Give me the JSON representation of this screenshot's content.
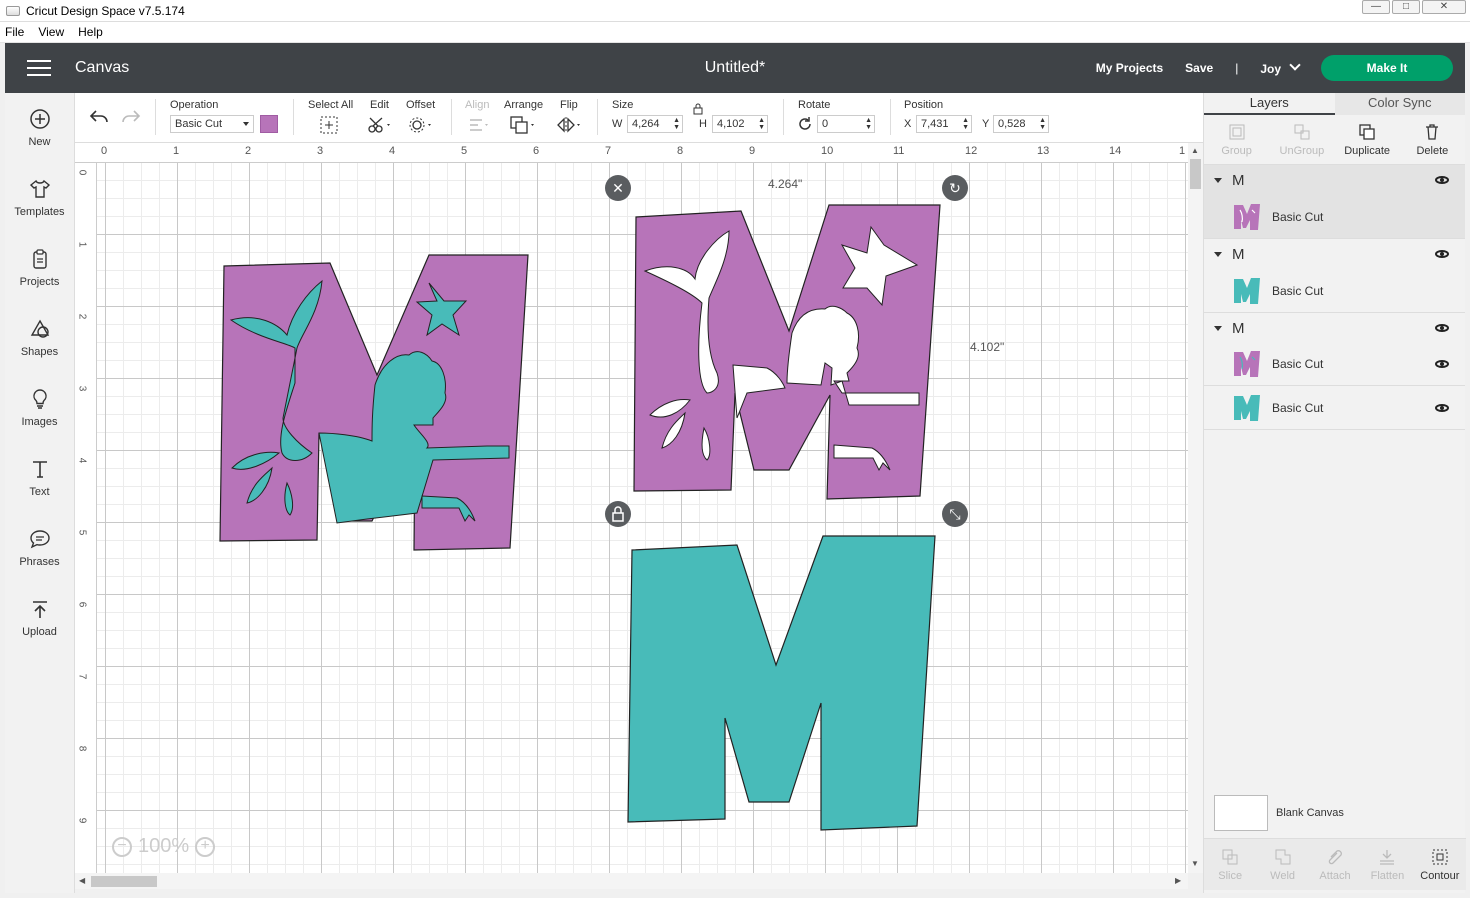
{
  "window": {
    "title": "Cricut Design Space  v7.5.174",
    "controls": [
      "—",
      "□",
      "✕"
    ]
  },
  "menu": [
    "File",
    "View",
    "Help"
  ],
  "header": {
    "section": "Canvas",
    "doc_title": "Untitled*",
    "my_projects": "My Projects",
    "save": "Save",
    "separator": "|",
    "user": "Joy",
    "make_it": "Make It",
    "accent": "#00a06a"
  },
  "leftbar": [
    {
      "label": "New",
      "icon": "plus-circle-icon"
    },
    {
      "label": "Templates",
      "icon": "shirt-icon"
    },
    {
      "label": "Projects",
      "icon": "clipboard-icon"
    },
    {
      "label": "Shapes",
      "icon": "shapes-icon"
    },
    {
      "label": "Images",
      "icon": "lightbulb-icon"
    },
    {
      "label": "Text",
      "icon": "text-icon"
    },
    {
      "label": "Phrases",
      "icon": "speech-bubble-icon"
    },
    {
      "label": "Upload",
      "icon": "upload-icon"
    }
  ],
  "toolbar": {
    "operation_label": "Operation",
    "operation_value": "Basic Cut",
    "operation_color": "#b774b9",
    "select_all": "Select All",
    "edit": "Edit",
    "offset": "Offset",
    "align": "Align",
    "arrange": "Arrange",
    "flip": "Flip",
    "size_label": "Size",
    "w_label": "W",
    "w_value": "4,264",
    "h_label": "H",
    "h_value": "4,102",
    "rotate_label": "Rotate",
    "rotate_value": "0",
    "position_label": "Position",
    "x_label": "X",
    "x_value": "7,431",
    "y_label": "Y",
    "y_value": "0,528"
  },
  "rulers": {
    "top": [
      "0",
      "1",
      "2",
      "3",
      "4",
      "5",
      "6",
      "7",
      "8",
      "9",
      "10",
      "11",
      "12",
      "13",
      "14",
      "1"
    ],
    "left": [
      "0",
      "1",
      "2",
      "3",
      "4",
      "5",
      "6",
      "7",
      "8",
      "9"
    ]
  },
  "canvas": {
    "width_label": "4.264\"",
    "height_label": "4.102\"",
    "zoom": "100%",
    "colors": {
      "purple": "#b774b9",
      "teal": "#48bbb9"
    }
  },
  "layers_panel": {
    "tabs": [
      "Layers",
      "Color Sync"
    ],
    "actions": [
      "Group",
      "UnGroup",
      "Duplicate",
      "Delete"
    ],
    "groups": [
      {
        "name": "M",
        "rows": [
          {
            "label": "Basic Cut",
            "thumb": "purple-m"
          }
        ]
      },
      {
        "name": "M",
        "rows": [
          {
            "label": "Basic Cut",
            "thumb": "teal-m"
          }
        ]
      },
      {
        "name": "M",
        "rows": [
          {
            "label": "Basic Cut",
            "thumb": "purple-m"
          },
          {
            "label": "Basic Cut",
            "thumb": "teal-m"
          }
        ]
      }
    ],
    "blank_canvas": "Blank Canvas",
    "bottom_actions": [
      "Slice",
      "Weld",
      "Attach",
      "Flatten",
      "Contour"
    ]
  }
}
